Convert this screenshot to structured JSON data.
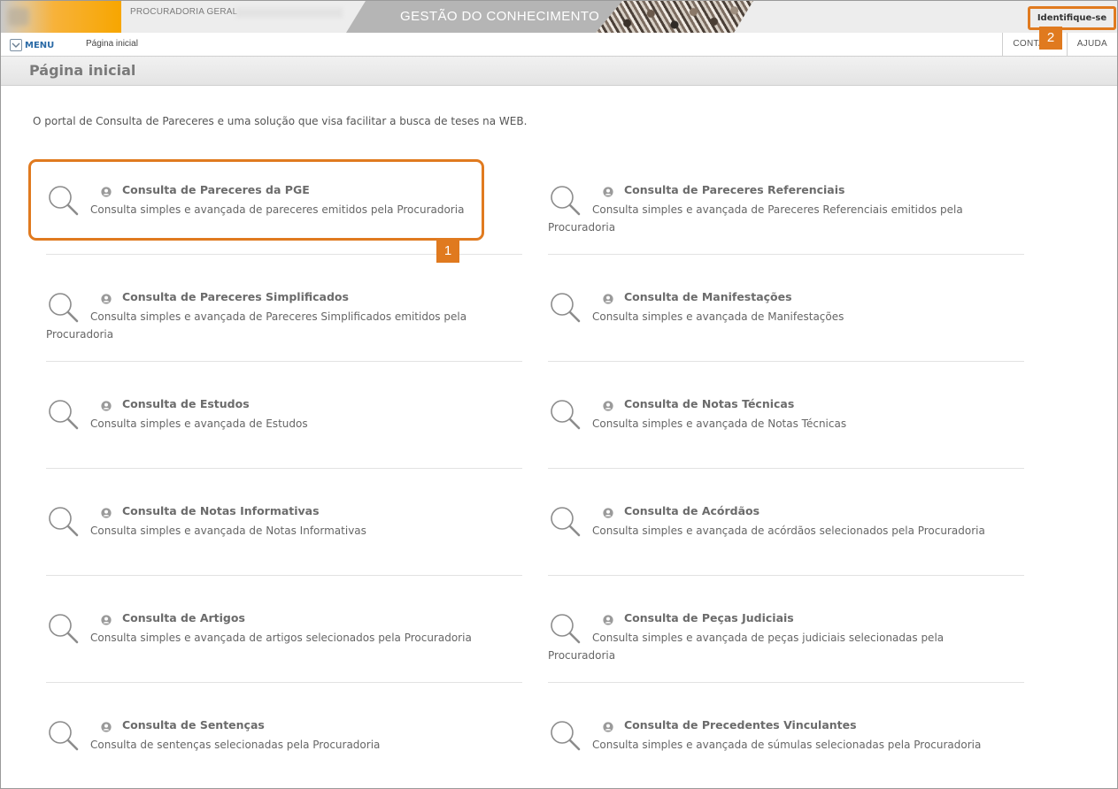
{
  "header": {
    "org_name": "PROCURADORIA GERAL",
    "banner_title": "GESTÃO DO CONHECIMENTO",
    "identify_label": "Identifique-se"
  },
  "nav": {
    "menu_label": "MENU",
    "breadcrumb": "Página inicial",
    "links": [
      "CONTATO",
      "AJUDA"
    ]
  },
  "page": {
    "title": "Página inicial",
    "intro": "O portal de Consulta de Pareceres e uma solução que visa facilitar a busca de teses na WEB."
  },
  "items": [
    {
      "title": "Consulta de Pareceres da PGE",
      "desc": "Consulta simples e avançada de pareceres emitidos pela Procuradoria"
    },
    {
      "title": "Consulta de Pareceres Referenciais",
      "desc": "Consulta simples e avançada de Pareceres Referenciais emitidos pela Procuradoria"
    },
    {
      "title": "Consulta de Pareceres Simplificados",
      "desc": "Consulta simples e avançada de Pareceres Simplificados emitidos pela Procuradoria"
    },
    {
      "title": "Consulta de Manifestações",
      "desc": "Consulta simples e avançada de Manifestações"
    },
    {
      "title": "Consulta de Estudos",
      "desc": "Consulta simples e avançada de Estudos"
    },
    {
      "title": "Consulta de Notas Técnicas",
      "desc": "Consulta simples e avançada de Notas Técnicas"
    },
    {
      "title": "Consulta de Notas Informativas",
      "desc": "Consulta simples e avançada de Notas Informativas"
    },
    {
      "title": "Consulta de Acórdãos",
      "desc": "Consulta simples e avançada de acórdãos selecionados pela Procuradoria"
    },
    {
      "title": "Consulta de Artigos",
      "desc": "Consulta simples e avançada de artigos selecionados pela Procuradoria"
    },
    {
      "title": "Consulta de Peças Judiciais",
      "desc": "Consulta simples e avançada de peças judiciais selecionadas pela Procuradoria"
    },
    {
      "title": "Consulta de Sentenças",
      "desc": "Consulta de sentenças selecionadas pela Procuradoria"
    },
    {
      "title": "Consulta de Precedentes Vinculantes",
      "desc": "Consulta simples e avançada de súmulas selecionadas pela Procuradoria"
    }
  ],
  "annotations": {
    "badge_1": "1",
    "badge_2": "2",
    "highlight_color": "#e07a1f"
  },
  "icons": {
    "item_search": "search-icon",
    "item_lock": "user-icon",
    "menu": "chevron-down-icon"
  }
}
